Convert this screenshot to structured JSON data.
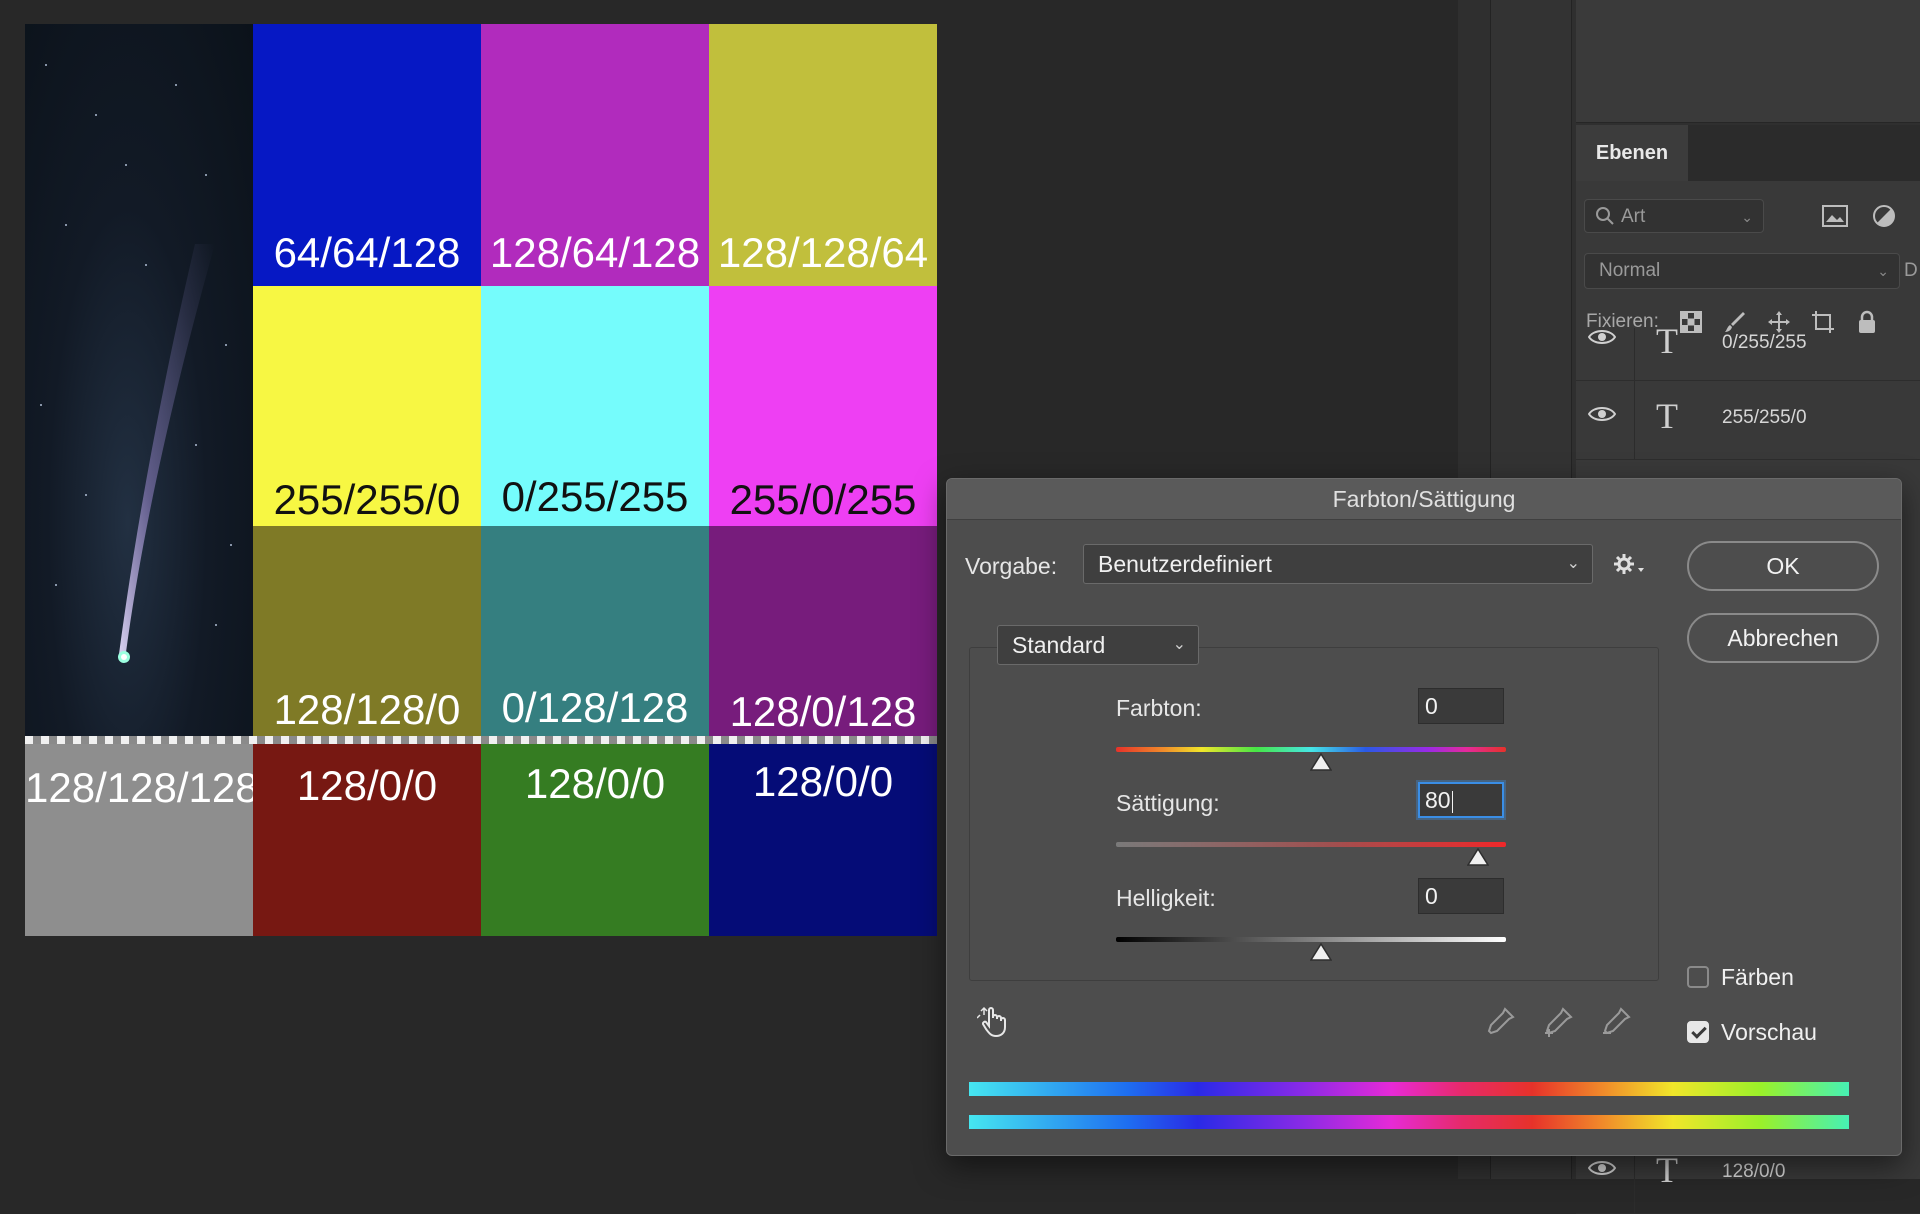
{
  "canvas": {
    "swatches": [
      {
        "label": "64/64/128",
        "bg": "#0618c4",
        "fg": "#ffffff"
      },
      {
        "label": "128/64/128",
        "bg": "#b12bbd",
        "fg": "#ffffff"
      },
      {
        "label": "128/128/64",
        "bg": "#c1bf3c",
        "fg": "#ffffff"
      },
      {
        "label": "255/255/0",
        "bg": "#f7f743",
        "fg": "#111111"
      },
      {
        "label": "0/255/255",
        "bg": "#75fcfc",
        "fg": "#111111"
      },
      {
        "label": "255/0/255",
        "bg": "#ee3ff3",
        "fg": "#111111"
      },
      {
        "label": "128/128/0",
        "bg": "#7f7a26",
        "fg": "#ffffff"
      },
      {
        "label": "0/128/128",
        "bg": "#357f80",
        "fg": "#ffffff"
      },
      {
        "label": "128/0/128",
        "bg": "#771c7c",
        "fg": "#ffffff"
      },
      {
        "label": "128/128/128",
        "bg": "#8e8e8e",
        "fg": "#ffffff"
      },
      {
        "label": "128/0/0",
        "bg": "#771812",
        "fg": "#ffffff"
      },
      {
        "label": "128/0/0",
        "bg": "#357c22",
        "fg": "#ffffff"
      },
      {
        "label": "128/0/0",
        "bg": "#050c77",
        "fg": "#ffffff"
      }
    ]
  },
  "layers_panel": {
    "tab_label": "Ebenen",
    "search_placeholder": "Art",
    "blend_mode": "Normal",
    "blend_extra": "D",
    "fix_label": "Fixieren:",
    "layers": [
      {
        "name": "0/255/255"
      },
      {
        "name": "255/255/0"
      },
      {
        "name": "128/0/0"
      }
    ]
  },
  "dialog": {
    "title": "Farbton/Sättigung",
    "preset_label": "Vorgabe:",
    "preset_value": "Benutzerdefiniert",
    "ok_label": "OK",
    "cancel_label": "Abbrechen",
    "channel_value": "Standard",
    "hue": {
      "label": "Farbton:",
      "value": "0"
    },
    "saturation": {
      "label": "Sättigung:",
      "value": "80"
    },
    "lightness": {
      "label": "Helligkeit:",
      "value": "0"
    },
    "colorize": {
      "label": "Färben",
      "checked": false
    },
    "preview": {
      "label": "Vorschau",
      "checked": true
    }
  }
}
